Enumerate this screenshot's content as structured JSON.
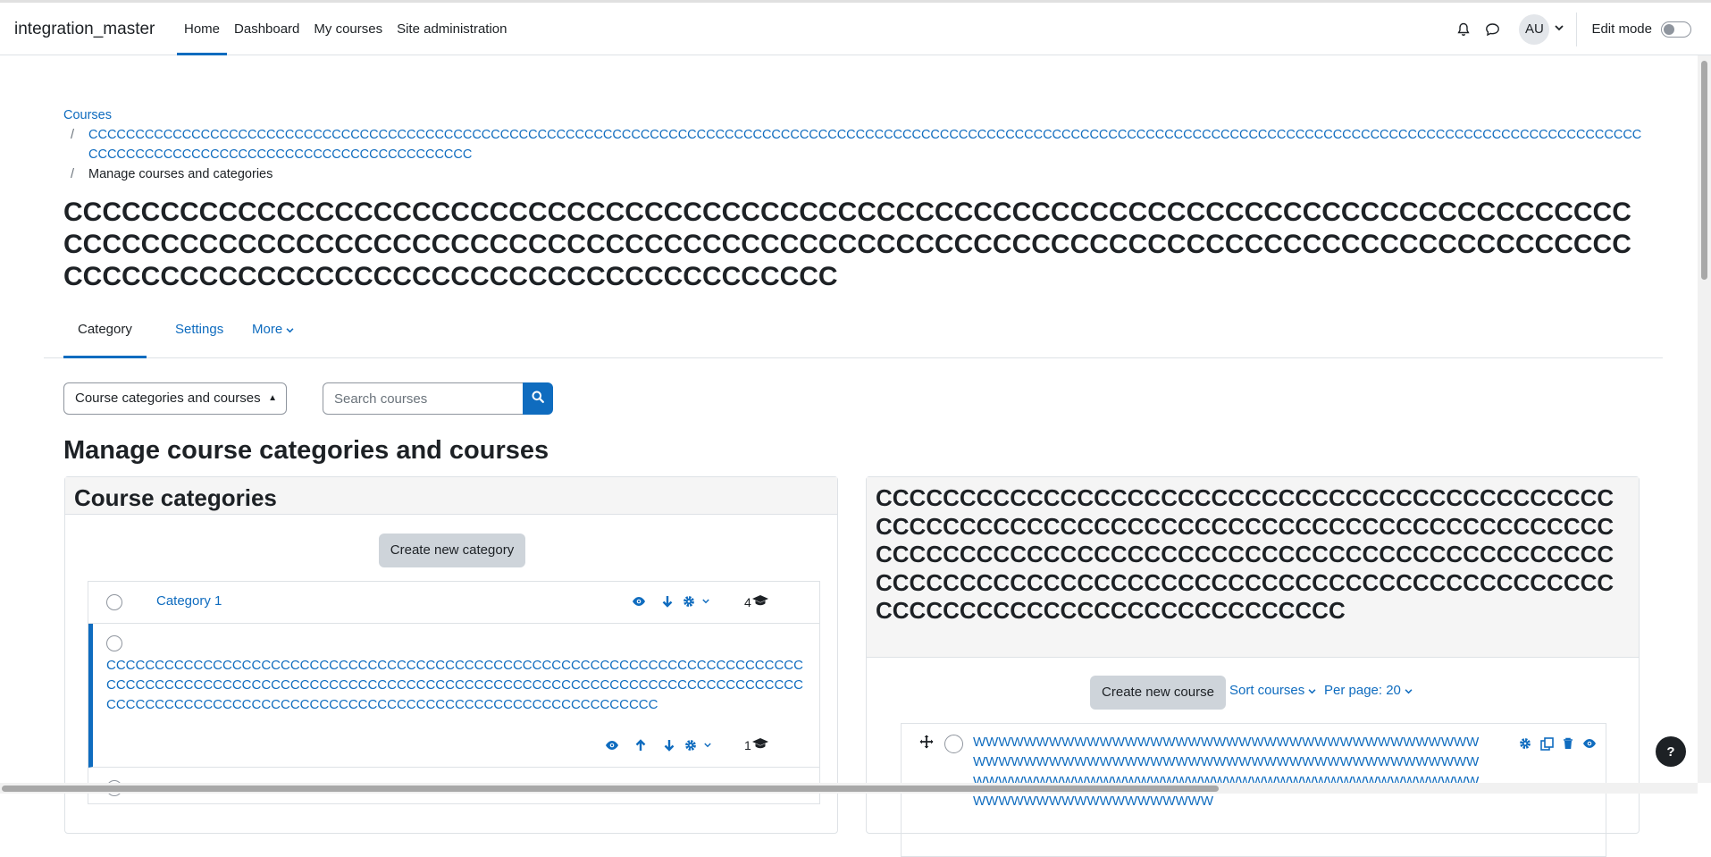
{
  "navbar": {
    "brand": "integration_master",
    "items": [
      {
        "label": "Home",
        "active": true
      },
      {
        "label": "Dashboard"
      },
      {
        "label": "My courses"
      },
      {
        "label": "Site administration"
      }
    ],
    "avatar_initials": "AU",
    "edit_mode_label": "Edit mode"
  },
  "breadcrumb": {
    "root": "Courses",
    "separator": "/",
    "category": "CCCCCCCCCCCCCCCCCCCCCCCCCCCCCCCCCCCCCCCCCCCCCCCCCCCCCCCCCCCCCCCCCCCCCCCCCCCCCCCCCCCCCCCCCCCCCCCCCCCCCCCCCCCCCCCCCCCCCCCCCCCCCCCCCCCCCCCCCCCCCCCCCCCCCCCCCCCCCCCCCCCCCCCCCCCCCCCCCCCCCCCCCCCCCCCCCCCCCCCCCCCCCCC",
    "current": "Manage courses and categories"
  },
  "page_heading": "CCCCCCCCCCCCCCCCCCCCCCCCCCCCCCCCCCCCCCCCCCCCCCCCCCCCCCCCCCCCCCCCCCCCCCCCCCCCCCCCCCCCCCCCCCCCCCCCCCCCCCCCCCCCCCCCCCCCCCCCCCCCCCCCCCCCCCCCCCCCCCCCCCCCCCCCCCCCCCCCCCCCCCCCCCCCCCCCCCCCCCCCCCCCCCCCCCCCCCCCCC",
  "secondary_nav": {
    "tabs": [
      {
        "label": "Category",
        "active": true
      },
      {
        "label": "Settings"
      },
      {
        "label": "More"
      }
    ]
  },
  "controls": {
    "view_select": "Course categories and courses",
    "search_placeholder": "Search courses"
  },
  "section_heading": "Manage course categories and courses",
  "categories_panel": {
    "title": "Course categories",
    "create_button": "Create new category",
    "rows": [
      {
        "name": "Category 1",
        "count": "4"
      },
      {
        "name": "CCCCCCCCCCCCCCCCCCCCCCCCCCCCCCCCCCCCCCCCCCCCCCCCCCCCCCCCCCCCCCCCCCCCCCCCCCCCCCCCCCCCCCCCCCCCCCCCCCCCCCCCCCCCCCCCCCCCCCCCCCCCCCCCCCCCCCCCCCCCCCCCCCCCCCCCCCCCCCCCCCCCCCCCCCCCCCCCCCCCCCCCCCCCCCCCCCCCCCCCC",
        "count": "1"
      }
    ]
  },
  "courses_panel": {
    "title": "CCCCCCCCCCCCCCCCCCCCCCCCCCCCCCCCCCCCCCCCCCCCCCCCCCCCCCCCCCCCCCCCCCCCCCCCCCCCCCCCCCCCCCCCCCCCCCCCCCCCCCCCCCCCCCCCCCCCCCCCCCCCCCCCCCCCCCCCCCCCCCCCCCCCCCCCCCCCCCCCCCCCCCCCCCCCCCCCCCCCCCCCCCCCCCCCCCCCCCCCCCCC",
    "create_button": "Create new course",
    "sort_label": "Sort courses",
    "per_page_label": "Per page: 20",
    "course_name": "WWWWWWWWWWWWWWWWWWWWWWWWWWWWWWWWWWWWWWWWWWWWWWWWWWWWWWWWWWWWWWWWWWWWWWWWWWWWWWWWWWWWWWWWWWWWWWWWWWWWWWWWWWWWWWWWWWWWWWWWWWWWWWWWWWWWWWWWWWW"
  },
  "help_label": "?",
  "colors": {
    "accent": "#0f6cbf",
    "text": "#1d2125",
    "border": "#dee2e6",
    "panel_bg": "#f5f5f5"
  },
  "icons": [
    "bell-icon",
    "chat-icon",
    "chevron-down-icon",
    "search-icon",
    "eye-icon",
    "arrow-down-icon",
    "arrow-up-icon",
    "gear-icon",
    "graduation-cap-icon",
    "move-icon",
    "copy-icon",
    "trash-icon",
    "help-icon"
  ]
}
